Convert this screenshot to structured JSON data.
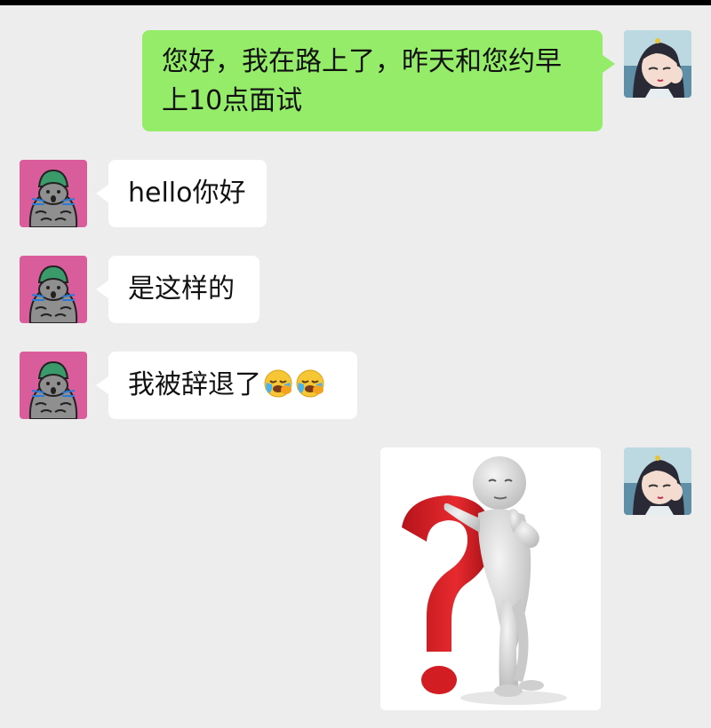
{
  "chat": {
    "messages": [
      {
        "side": "out",
        "type": "text",
        "text": "您好，我在路上了，昨天和您约早上10点面试"
      },
      {
        "side": "in",
        "type": "text",
        "text": "hello你好"
      },
      {
        "side": "in",
        "type": "text",
        "text": "是这样的"
      },
      {
        "side": "in",
        "type": "text",
        "text": "我被辞退了",
        "emojis": [
          "crying-emoji",
          "crying-emoji"
        ]
      },
      {
        "side": "out",
        "type": "image",
        "image": "thinking-figure-with-question-mark"
      }
    ]
  },
  "colors": {
    "background": "#ededed",
    "outgoing_bubble": "#95ec69",
    "incoming_bubble": "#ffffff",
    "contact_avatar_bg": "#d95c9b",
    "question_mark": "#e0262a"
  }
}
